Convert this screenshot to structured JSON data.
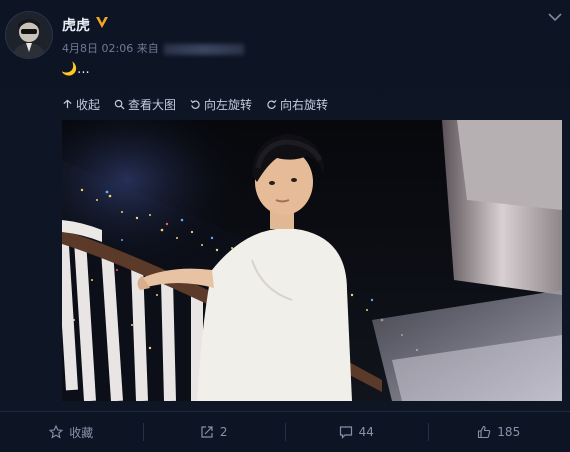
{
  "user": {
    "name": "虎虎"
  },
  "post": {
    "date": "4月8日 02:06",
    "source_prefix": "来自",
    "text": "🌙..."
  },
  "toolbar": {
    "collapse": "收起",
    "view_large": "查看大图",
    "rotate_left": "向左旋转",
    "rotate_right": "向右旋转"
  },
  "footer": {
    "favorite": "收藏",
    "repost_count": "2",
    "comment_count": "44",
    "like_count": "185"
  },
  "colors": {
    "background": "#0b1220",
    "verified_badge": "#f5a623"
  }
}
